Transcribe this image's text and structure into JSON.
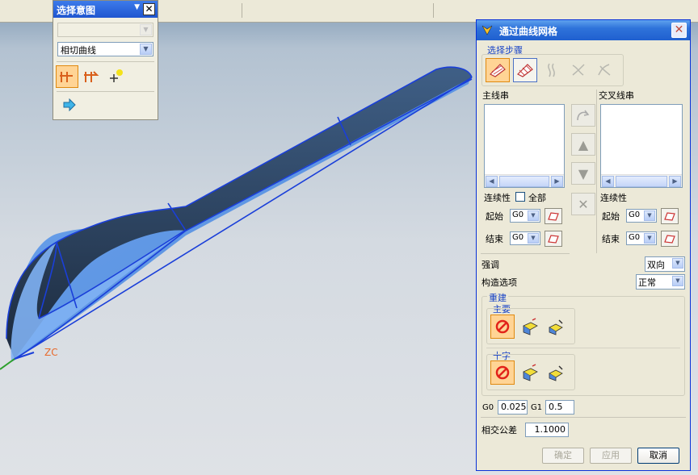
{
  "intent_palette": {
    "title": "选择意图",
    "combo1_value": "",
    "combo2_value": "相切曲线"
  },
  "viewport": {
    "axis_label": "ZC"
  },
  "dialog": {
    "title": "通过曲线网格",
    "step_section_title": "选择步骤",
    "primary_label": "主线串",
    "cross_label": "交叉线串",
    "continuity_label_primary": "连续性",
    "all_label": "全部",
    "continuity_label_cross": "连续性",
    "start_label": "起始",
    "end_label": "结束",
    "start_value_primary": "G0",
    "end_value_primary": "G0",
    "start_label_cross": "起始",
    "end_label_cross": "结束",
    "start_value_cross": "G0",
    "end_value_cross": "G0",
    "emphasis_label": "强调",
    "emphasis_value": "双向",
    "construction_label": "构造选项",
    "construction_value": "正常",
    "rebuild_title": "重建",
    "rebuild_primary_title": "主要",
    "rebuild_cross_title": "十字",
    "g0_label": "G0",
    "g0_value": "0.025",
    "g1_label": "G1",
    "g1_value": "0.5",
    "intersect_tol_label": "相交公差",
    "intersect_tol_value": "1.1000",
    "ok_label": "确定",
    "apply_label": "应用",
    "cancel_label": "取消"
  },
  "colors": {
    "title_blue": "#1f5fcf",
    "highlight_orange": "#ffd495",
    "surface_blue": "#5c8fd6",
    "surface_dark": "#2a3f5c",
    "edge_blue": "#1a3fd9"
  }
}
